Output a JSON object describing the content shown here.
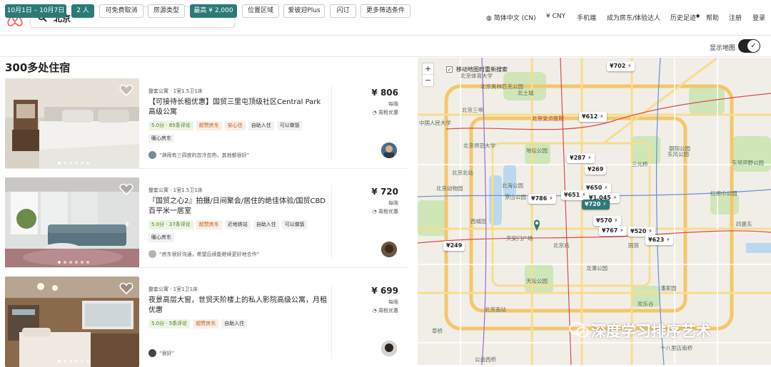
{
  "header": {
    "search_value": "北京",
    "nav": [
      {
        "icon": "globe-icon",
        "label": "简体中文 (CN)"
      },
      {
        "label": "¥ CNY"
      },
      {
        "label": "手机端"
      },
      {
        "label": "成为房东/体验达人"
      },
      {
        "label": "历史足迹"
      },
      {
        "label": "帮助"
      },
      {
        "label": "注册"
      },
      {
        "label": "登录"
      }
    ]
  },
  "filters": {
    "chips": [
      "10月1日 – 10月7日",
      "2 人",
      "可免费取消",
      "房源类型",
      "最高 ¥ 2,000",
      "位置区域",
      "爱彼迎Plus",
      "闪订",
      "更多筛选条件"
    ],
    "active": [
      0,
      1,
      4
    ],
    "show_map_label": "显示地图",
    "show_map_on": true
  },
  "results": {
    "count_label": "300多处住宿",
    "listings": [
      {
        "meta": "整套公寓 · 1室1.5卫1床",
        "title": "【可接待长租优惠】国贸三里屯顶级社区Central Park高级公寓",
        "tags": [
          "5.0分 · 85条评论",
          "超赞房东",
          "安心住",
          "自助入住",
          "可以做饭",
          "暖心房东"
        ],
        "review": "“淋雨有三四度的忽冷忽热，其他都很好”",
        "price": "¥ 806",
        "per": "每晚",
        "discount": "周租优惠"
      },
      {
        "meta": "整套公寓 · 1室1.5卫1床",
        "title": "『国贸之心2』拍摄/日间聚会/居住的绝佳体验/国贸CBD百平米一居室",
        "tags": [
          "5.0分 · 37条评论",
          "超赞房东",
          "近地铁站",
          "自助入住",
          "可以做饭",
          "暖心房东"
        ],
        "review": "“房东很好沟通，希望后续能继续更好地合作”",
        "price": "¥ 720",
        "per": "每晚",
        "discount": "周租优惠"
      },
      {
        "meta": "整套公寓 · 1室1卫1床",
        "title": "夜景高层大窗，世贸天阶楼上的私人影院高级公寓，月租优惠",
        "tags": [
          "5.0分 · 5条评论",
          "超赞房东",
          "自助入住"
        ],
        "review": "“很好”",
        "price": "¥ 699",
        "per": "每晚",
        "discount": "周租优惠"
      }
    ]
  },
  "map": {
    "zoom_in": "+",
    "zoom_out": "−",
    "move_search_label": "移动地图时重新搜索",
    "pins": [
      "¥702 ⚡",
      "¥612 ⚡",
      "¥287 ⚡",
      "¥269",
      "¥650 ⚡",
      "¥1,045 ⚡",
      "¥651 ⚡",
      "¥786 ⚡",
      "¥720 ⚡",
      "¥570 ⚡",
      "¥767 ⚡",
      "¥520 ⚡",
      "¥623 ⚡",
      "¥249"
    ],
    "selected_pin": 8,
    "places": [
      "北京奥林匹克公园",
      "北京体育大学",
      "北土城",
      "北京三帝",
      "中国人民大学",
      "北京安贞医院",
      "北京师范大学",
      "地坛公园",
      "北京动物园",
      "北京北站",
      "北海公园",
      "景山公园",
      "西城区",
      "北京站",
      "天坛公园",
      "北京南站",
      "天安门广场",
      "朝阳公园",
      "东风公园",
      "红领巾公园",
      "十八里店南桥",
      "欢乐谷",
      "三元桥",
      "国贸",
      "东坝郊野公园",
      "潘家园",
      "草桥",
      "公益西桥",
      "四惠东",
      "龙潭公园"
    ],
    "watermark": "深度学习排序艺术"
  },
  "colors": {
    "accent": "#2b7a78",
    "brand": "#ff5a5f",
    "green_tag": "#4a7a1a",
    "orange_tag": "#c05a1a"
  }
}
